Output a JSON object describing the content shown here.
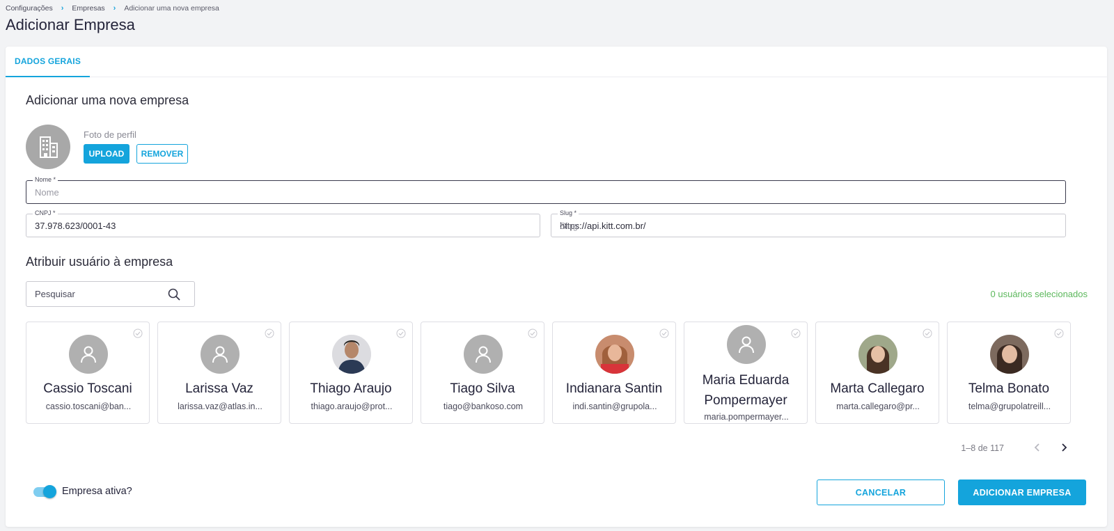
{
  "breadcrumb": {
    "items": [
      "Configurações",
      "Empresas"
    ],
    "current": "Adicionar uma nova empresa"
  },
  "page_title": "Adicionar Empresa",
  "tabs": [
    {
      "label": "DADOS GERAIS"
    }
  ],
  "form": {
    "section_title": "Adicionar uma nova empresa",
    "photo_label": "Foto de perfil",
    "upload_label": "UPLOAD",
    "remove_label": "REMOVER",
    "nome": {
      "label": "Nome *",
      "placeholder": "Nome",
      "value": ""
    },
    "cnpj": {
      "label": "CNPJ *",
      "value": "37.978.623/0001-43"
    },
    "slug": {
      "label": "Slug *",
      "prefix": "https://api.kitt.com.br/",
      "placeholder": "Slug",
      "value": ""
    }
  },
  "users_section": {
    "title": "Atribuir usuário à empresa",
    "search_placeholder": "Pesquisar",
    "selected_count": "0 usuários selecionados",
    "users": [
      {
        "name": "Cassio Toscani",
        "email": "cassio.toscani@ban...",
        "avatar": "placeholder-icon"
      },
      {
        "name": "Larissa Vaz",
        "email": "larissa.vaz@atlas.in...",
        "avatar": "placeholder-icon"
      },
      {
        "name": "Thiago Araujo",
        "email": "thiago.araujo@prot...",
        "avatar": "photo"
      },
      {
        "name": "Tiago Silva",
        "email": "tiago@bankoso.com",
        "avatar": "placeholder-icon"
      },
      {
        "name": "Indianara Santin",
        "email": "indi.santin@grupola...",
        "avatar": "photo"
      },
      {
        "name": "Maria Eduarda Pompermayer",
        "email": "maria.pompermayer...",
        "avatar": "placeholder-icon"
      },
      {
        "name": "Marta Callegaro",
        "email": "marta.callegaro@pr...",
        "avatar": "photo"
      },
      {
        "name": "Telma Bonato",
        "email": "telma@grupolatreill...",
        "avatar": "photo"
      }
    ],
    "pagination": "1–8 de 117"
  },
  "footer": {
    "toggle_label": "Empresa ativa?",
    "toggle_on": true,
    "cancel_label": "CANCELAR",
    "add_label": "ADICIONAR EMPRESA"
  },
  "colors": {
    "accent": "#14a4dc",
    "success": "#5cb85c",
    "placeholder_avatar": "#b0b0b0"
  }
}
